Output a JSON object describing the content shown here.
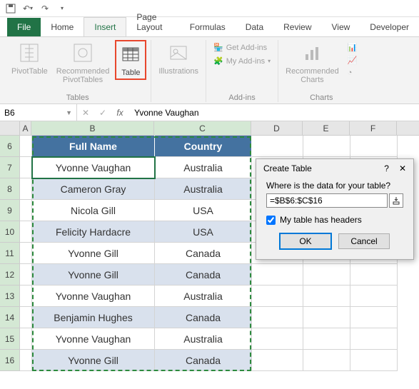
{
  "qat": {
    "save": "save-icon",
    "undo": "undo-icon",
    "redo": "redo-icon"
  },
  "tabs": {
    "file": "File",
    "home": "Home",
    "insert": "Insert",
    "page_layout": "Page Layout",
    "formulas": "Formulas",
    "data": "Data",
    "review": "Review",
    "view": "View",
    "developer": "Developer"
  },
  "ribbon": {
    "tables": {
      "pivot": "PivotTable",
      "recommended": "Recommended\nPivotTables",
      "table": "Table",
      "group": "Tables"
    },
    "illustrations": {
      "label": "Illustrations"
    },
    "addins": {
      "get": "Get Add-ins",
      "my": "My Add-ins",
      "group": "Add-ins"
    },
    "charts": {
      "recommended": "Recommended\nCharts",
      "group": "Charts"
    }
  },
  "namebox": "B6",
  "formula": "Yvonne Vaughan",
  "columns": [
    "A",
    "B",
    "C",
    "D",
    "E",
    "F"
  ],
  "rows_start": 6,
  "table": {
    "headers": [
      "Full Name",
      "Country"
    ],
    "rows": [
      [
        "Yvonne Vaughan",
        "Australia"
      ],
      [
        "Cameron Gray",
        "Australia"
      ],
      [
        "Nicola Gill",
        "USA"
      ],
      [
        "Felicity Hardacre",
        "USA"
      ],
      [
        "Yvonne Gill",
        "Canada"
      ],
      [
        "Yvonne Gill",
        "Canada"
      ],
      [
        "Yvonne Vaughan",
        "Australia"
      ],
      [
        "Benjamin Hughes",
        "Canada"
      ],
      [
        "Yvonne Vaughan",
        "Australia"
      ],
      [
        "Yvonne Gill",
        "Canada"
      ]
    ]
  },
  "dialog": {
    "title": "Create Table",
    "help": "?",
    "close": "✕",
    "where": "Where is the data for your table?",
    "range": "=$B$6:$C$16",
    "headers_chk": "My table has headers",
    "ok": "OK",
    "cancel": "Cancel"
  }
}
